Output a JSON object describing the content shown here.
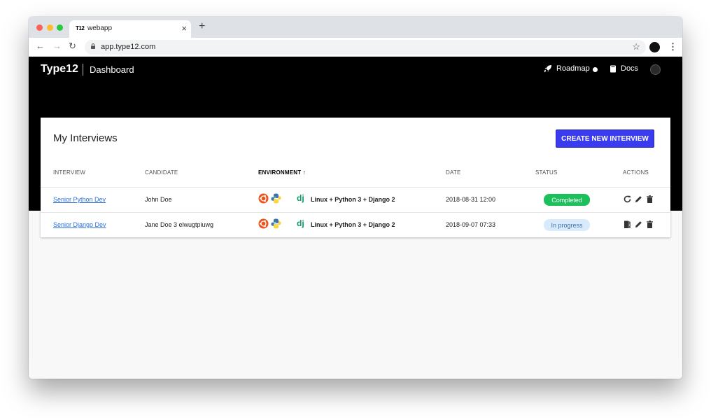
{
  "browser": {
    "tab_title": "webapp",
    "tab_favicon": "T12",
    "tab_close": "×",
    "new_tab": "+",
    "url": "app.type12.com",
    "back": "←",
    "forward": "→",
    "reload": "↻",
    "star": "☆",
    "menu": "⋮"
  },
  "header": {
    "brand": "Type12",
    "section": "Dashboard",
    "roadmap_label": "Roadmap",
    "docs_label": "Docs"
  },
  "card": {
    "title": "My Interviews",
    "create_button": "CREATE NEW INTERVIEW"
  },
  "table": {
    "columns": {
      "interview": "INTERVIEW",
      "candidate": "CANDIDATE",
      "environment": "ENVIRONMENT",
      "environment_sort": "↑",
      "date": "DATE",
      "status": "STATUS",
      "actions": "ACTIONS"
    },
    "rows": [
      {
        "interview": "Senior Python Dev",
        "candidate": "John Doe",
        "environment": "Linux + Python 3 + Django 2",
        "date": "2018-08-31 12:00",
        "status": "Completed"
      },
      {
        "interview": "Senior Django Dev",
        "candidate": "Jane Doe 3 elwugtpiuwg",
        "environment": "Linux + Python 3 + Django 2",
        "date": "2018-09-07 07:33",
        "status": "In progress"
      }
    ]
  },
  "colors": {
    "primary_button": "#3b3bf0",
    "completed_badge": "#1bbf5c",
    "in_progress_badge": "#d9ebfb",
    "link": "#2a6fdb",
    "header_bg": "#000000"
  }
}
